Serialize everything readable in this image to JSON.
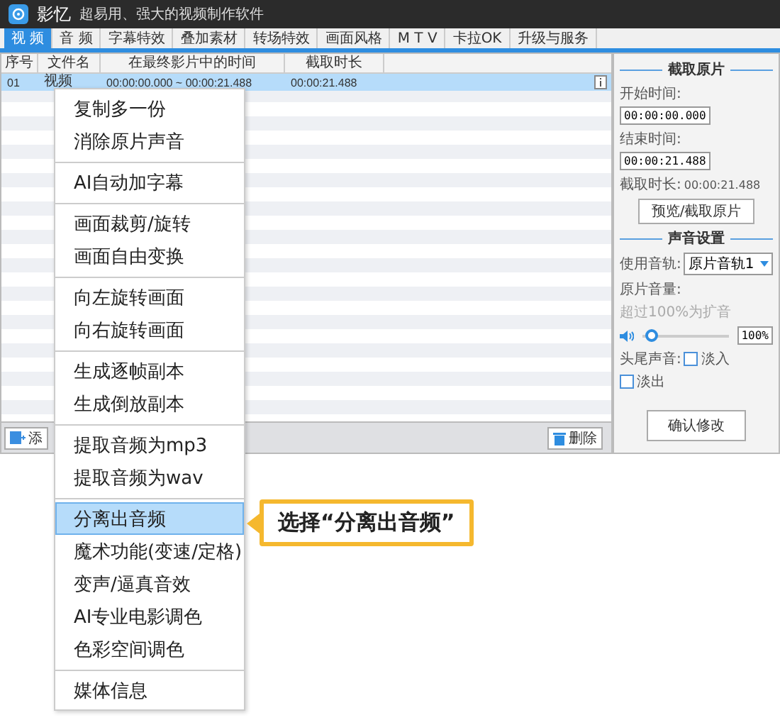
{
  "window": {
    "app_name": "影忆",
    "subtitle": "超易用、强大的视频制作软件"
  },
  "tabs": [
    {
      "label": "视 频",
      "selected": true
    },
    {
      "label": "音 频",
      "selected": false
    },
    {
      "label": "字幕特效",
      "selected": false
    },
    {
      "label": "叠加素材",
      "selected": false
    },
    {
      "label": "转场特效",
      "selected": false
    },
    {
      "label": "画面风格",
      "selected": false
    },
    {
      "label": "M T V",
      "selected": false
    },
    {
      "label": "卡拉OK",
      "selected": false
    },
    {
      "label": "升级与服务",
      "selected": false
    }
  ],
  "table": {
    "columns": [
      "序号",
      "文件名",
      "在最终影片中的时间",
      "截取时长"
    ],
    "rows": [
      {
        "index": "01",
        "name": "视频",
        "time_range": "00:00:00.000 ~ 00:00:21.488",
        "duration": "00:00:21.488",
        "selected": true
      }
    ]
  },
  "toolbar": {
    "add_button": "添",
    "delete_button": "删除"
  },
  "context_menu": {
    "groups": [
      [
        {
          "label": "复制多一份",
          "selected": false
        },
        {
          "label": "消除原片声音",
          "selected": false
        }
      ],
      [
        {
          "label": "AI自动加字幕",
          "selected": false
        }
      ],
      [
        {
          "label": "画面裁剪/旋转",
          "selected": false
        },
        {
          "label": "画面自由变换",
          "selected": false
        }
      ],
      [
        {
          "label": "向左旋转画面",
          "selected": false
        },
        {
          "label": "向右旋转画面",
          "selected": false
        }
      ],
      [
        {
          "label": "生成逐帧副本",
          "selected": false
        },
        {
          "label": "生成倒放副本",
          "selected": false
        }
      ],
      [
        {
          "label": "提取音频为mp3",
          "selected": false
        },
        {
          "label": "提取音频为wav",
          "selected": false
        }
      ],
      [
        {
          "label": "分离出音频",
          "selected": true
        },
        {
          "label": "魔术功能(变速/定格)",
          "selected": false
        },
        {
          "label": "变声/逼真音效",
          "selected": false
        },
        {
          "label": "AI专业电影调色",
          "selected": false
        },
        {
          "label": "色彩空间调色",
          "selected": false
        }
      ],
      [
        {
          "label": "媒体信息",
          "selected": false
        }
      ]
    ]
  },
  "callout": {
    "text": "选择“分离出音频”"
  },
  "trim_panel": {
    "title": "截取原片",
    "start_label": "开始时间:",
    "start_value": "00:00:00.000",
    "end_label": "结束时间:",
    "end_value": "00:00:21.488",
    "duration_label": "截取时长:",
    "duration_value": "00:00:21.488",
    "preview_button": "预览/截取原片"
  },
  "audio_settings": {
    "title": "声音设置",
    "track_label": "使用音轨:",
    "track_value": "原片音轨1",
    "volume_label": "原片音量:",
    "volume_hint": "超过100%为扩音",
    "volume": {
      "level": 0.1,
      "reading": "100%"
    },
    "fade_label": "头尾声音:",
    "fades": [
      {
        "label": "淡入",
        "checked": false
      },
      {
        "label": "淡出",
        "checked": false
      }
    ]
  },
  "confirm_button": "确认修改"
}
